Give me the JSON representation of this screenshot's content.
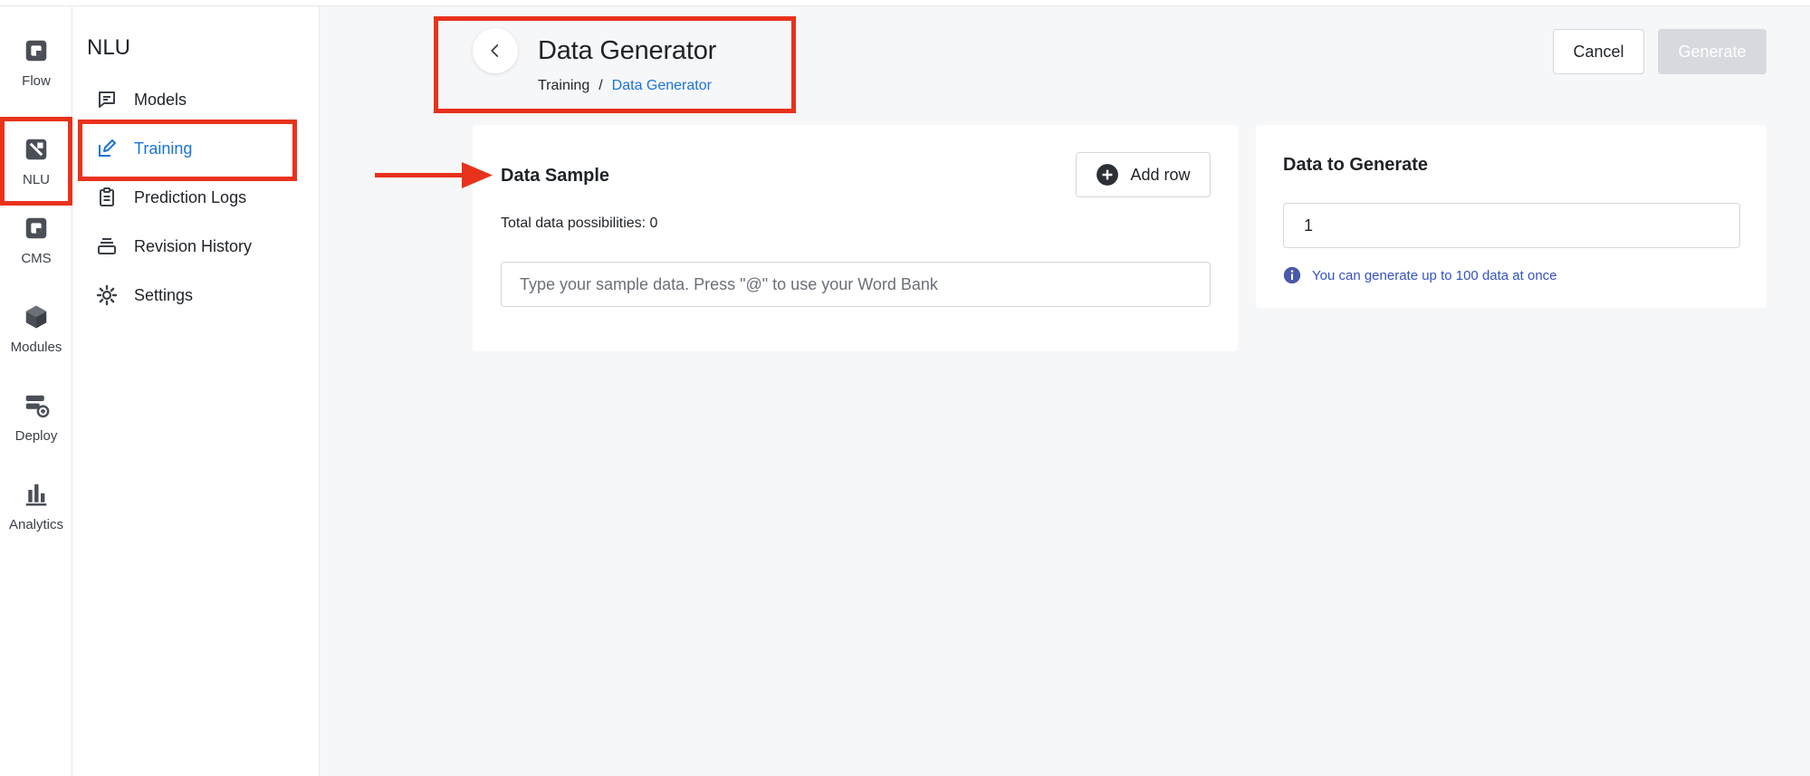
{
  "rail": {
    "items": [
      {
        "label": "Flow",
        "icon": "flow-icon"
      },
      {
        "label": "NLU",
        "icon": "nlu-icon"
      },
      {
        "label": "CMS",
        "icon": "cms-icon"
      },
      {
        "label": "Modules",
        "icon": "modules-icon"
      },
      {
        "label": "Deploy",
        "icon": "deploy-icon"
      },
      {
        "label": "Analytics",
        "icon": "analytics-icon"
      }
    ]
  },
  "subnav": {
    "title": "NLU",
    "items": [
      {
        "label": "Models",
        "icon": "chat-icon"
      },
      {
        "label": "Training",
        "icon": "edit-icon"
      },
      {
        "label": "Prediction Logs",
        "icon": "clipboard-icon"
      },
      {
        "label": "Revision History",
        "icon": "layers-icon"
      },
      {
        "label": "Settings",
        "icon": "gear-icon"
      }
    ]
  },
  "header": {
    "title": "Data Generator",
    "breadcrumb": {
      "parent": "Training",
      "separator": "/",
      "current": "Data Generator"
    },
    "cancel_label": "Cancel",
    "generate_label": "Generate"
  },
  "sample": {
    "title": "Data Sample",
    "add_row_label": "Add row",
    "total_line": "Total data possibilities: 0",
    "input_placeholder": "Type your sample data. Press \"@\" to use your Word Bank",
    "input_value": ""
  },
  "generate": {
    "title": "Data to Generate",
    "value": "1",
    "hint": "You can generate up to 100 data at once"
  },
  "colors": {
    "accent": "#1a73d9",
    "annotation": "#e8321c",
    "hint": "#3552c4",
    "disabled_button": "#d6dadf"
  }
}
